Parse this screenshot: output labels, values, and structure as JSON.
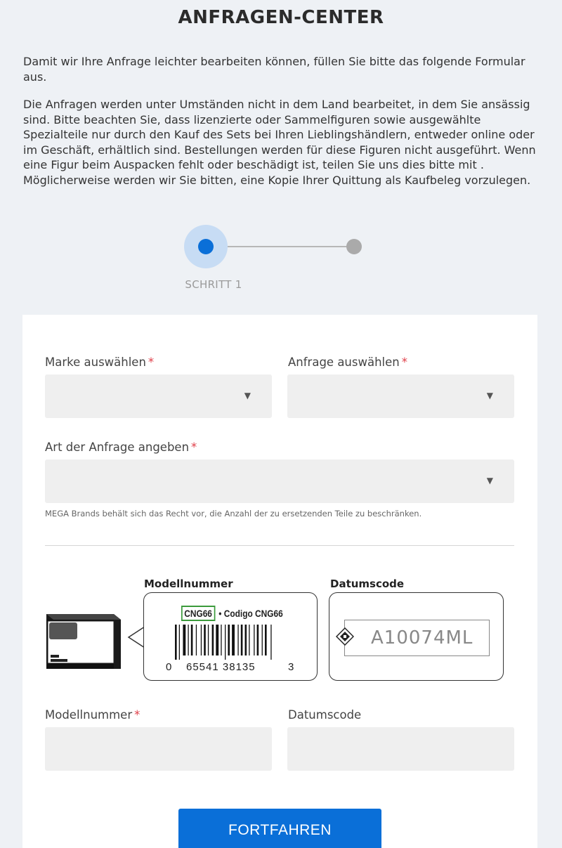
{
  "page": {
    "title": "ANFRAGEN-CENTER",
    "intro_1": "Damit wir Ihre Anfrage leichter bearbeiten können, füllen Sie bitte das folgende Formular aus.",
    "intro_2": "Die Anfragen werden unter Umständen nicht in dem Land bearbeitet, in dem Sie ansässig sind. Bitte beachten Sie, dass lizenzierte oder Sammelfiguren sowie ausgewählte Spezialteile nur durch den Kauf des Sets bei Ihren Lieblingshändlern, entweder online oder im Geschäft, erhältlich sind. Bestellungen werden für diese Figuren nicht ausgeführt. Wenn eine Figur beim Auspacken fehlt oder beschädigt ist, teilen Sie uns dies bitte mit . Möglicherweise werden wir Sie bitten, eine Kopie Ihrer Quittung als Kaufbeleg vorzulegen."
  },
  "stepper": {
    "current_step_label": "SCHRITT 1",
    "total_steps": 2,
    "current_step": 1
  },
  "form": {
    "brand": {
      "label": "Marke auswählen",
      "required_mark": "*",
      "value": ""
    },
    "request": {
      "label": "Anfrage auswählen",
      "required_mark": "*",
      "value": ""
    },
    "request_type": {
      "label": "Art der Anfrage angeben",
      "required_mark": "*",
      "value": ""
    },
    "note": "MEGA Brands behält sich das Recht vor, die Anzahl der zu ersetzenden Teile zu beschränken.",
    "model_number": {
      "label": "Modellnummer",
      "required_mark": "*",
      "value": ""
    },
    "date_code": {
      "label": "Datumscode",
      "value": ""
    },
    "submit_label": "FORTFAHREN"
  },
  "illustration": {
    "model_heading": "Modellnummer",
    "date_heading": "Datumscode",
    "model_code": "CNG66",
    "model_codigo": "• Codigo CNG66",
    "barcode_digit_left": "0",
    "barcode_digits_main": "65541 38135",
    "barcode_digit_right": "3",
    "date_sample": "A10074ML"
  },
  "colors": {
    "accent": "#0a6fd8",
    "required": "#e0404a",
    "field_bg": "#efefef",
    "page_bg": "#eef1f5",
    "model_highlight": "#3b9a3b"
  }
}
